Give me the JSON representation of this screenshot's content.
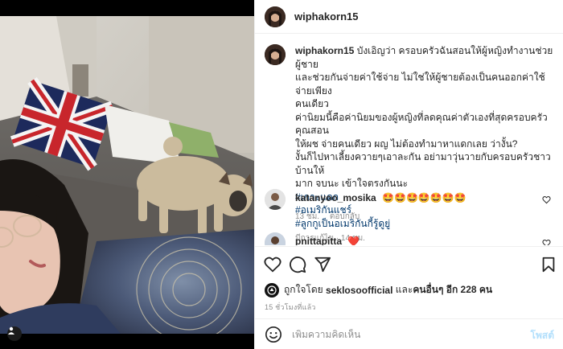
{
  "post": {
    "username": "wiphakorn15",
    "photo_description": "selfie"
  },
  "caption": {
    "username": "wiphakorn15",
    "lines": [
      "บังเอิญว่า ครอบครัวฉันสอนให้ผู้หญิงทำงานช่วยผู้ชาย",
      "และช่วยกันจ่ายค่าใช้จ่าย ไม่ใช่ให้ผู้ชายต้องเป็นคนออกค่าใช้จ่ายเพียง",
      "คนเดียว",
      "ค่านิยมนี้คือค่านิยมของผู้หญิงที่ลดคุณค่าตัวเองที่สุดครอบครัวคุณสอน",
      "ให้ผช จ่ายคนเดียว ผญ ไม่ต้องทำมาหาแดกเลย ว่างั้น?",
      "งั้นก็ไปหาเลี้ยงควายๆเอาละกัน อย่ามาวุ่นวายกับครอบครัวชาวบ้านให้",
      "มาก จบนะ เข้าใจตรงกันนะ"
    ],
    "hashtags": [
      "#เกาะแดก",
      "#อเมริกันแชร์",
      "#ลูกกูเป็นอเมริกันกี้รู้ดูยู่"
    ],
    "edited_label": "มีการแก้ไข",
    "time": "14 ชม."
  },
  "comments": [
    {
      "username": "katanyoo_mosika",
      "text": "🤩🤩🤩🤩🤩🤩🤩",
      "time": "13 ชม.",
      "reply_label": "ตอบกลับ"
    },
    {
      "username": "pnittapitta",
      "text": "❤️"
    }
  ],
  "likes": {
    "prefix": "ถูกใจโดย",
    "first_liker": "seklosoofficial",
    "middle": "และ",
    "others_label": "คนอื่นๆ อีก 228 คน"
  },
  "timestamp": "15 ชั่วโมงที่แล้ว",
  "add_comment": {
    "placeholder": "เพิ่มความคิดเห็น",
    "post_label": "โพสต์"
  },
  "icons": {
    "like": "heart-icon",
    "comment": "comment-icon",
    "share": "send-icon",
    "save": "bookmark-icon",
    "emoji": "smiley-icon",
    "user_tag": "person-icon"
  },
  "colors": {
    "hashtag": "#00376b",
    "muted": "#8e8e8e",
    "post_button_disabled": "#b2dffc",
    "heart_red": "#ed4956"
  }
}
